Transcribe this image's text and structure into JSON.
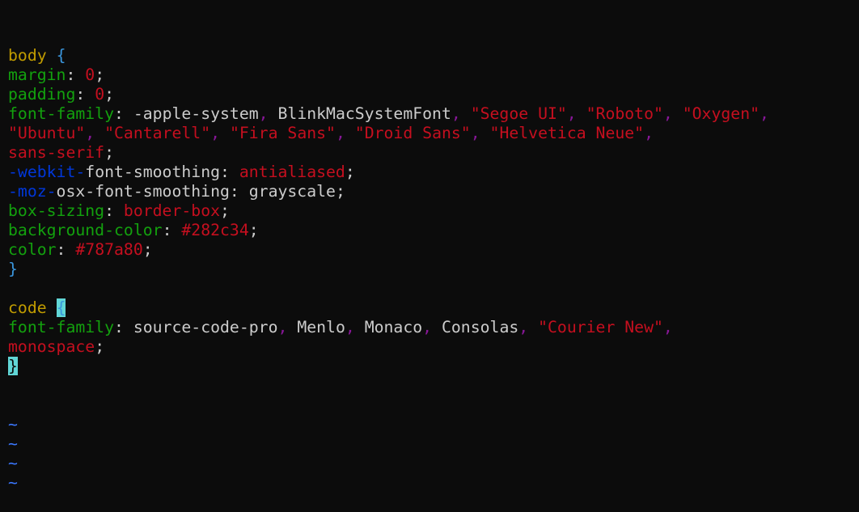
{
  "colors": {
    "background": "#0c0c0c",
    "selector": "#c19c00",
    "brace": "#3a96dd",
    "property": "#13a10e",
    "punctuation": "#cccccc",
    "value": "#c50f1f",
    "separator": "#881798",
    "vendor_prefix": "#0037da",
    "plain": "#cccccc",
    "cursor_bg": "#61d6d6",
    "cursor_fg": "#0c0c0c",
    "tilde": "#3b78ff"
  },
  "lines": [
    [
      {
        "t": "body",
        "c": "selector"
      },
      {
        "t": " ",
        "c": "plain"
      },
      {
        "t": "{",
        "c": "brace"
      }
    ],
    [
      {
        "t": "margin",
        "c": "property"
      },
      {
        "t": ": ",
        "c": "punctuation"
      },
      {
        "t": "0",
        "c": "value"
      },
      {
        "t": ";",
        "c": "punctuation"
      }
    ],
    [
      {
        "t": "padding",
        "c": "property"
      },
      {
        "t": ": ",
        "c": "punctuation"
      },
      {
        "t": "0",
        "c": "value"
      },
      {
        "t": ";",
        "c": "punctuation"
      }
    ],
    [
      {
        "t": "font-family",
        "c": "property"
      },
      {
        "t": ": ",
        "c": "punctuation"
      },
      {
        "t": "-apple-system",
        "c": "plain"
      },
      {
        "t": ", ",
        "c": "separator"
      },
      {
        "t": "BlinkMacSystemFont",
        "c": "plain"
      },
      {
        "t": ", ",
        "c": "separator"
      },
      {
        "t": "\"Segoe UI\"",
        "c": "value"
      },
      {
        "t": ", ",
        "c": "separator"
      },
      {
        "t": "\"Roboto\"",
        "c": "value"
      },
      {
        "t": ", ",
        "c": "separator"
      },
      {
        "t": "\"Oxygen\"",
        "c": "value"
      },
      {
        "t": ",",
        "c": "separator"
      }
    ],
    [
      {
        "t": "\"Ubuntu\"",
        "c": "value"
      },
      {
        "t": ", ",
        "c": "separator"
      },
      {
        "t": "\"Cantarell\"",
        "c": "value"
      },
      {
        "t": ", ",
        "c": "separator"
      },
      {
        "t": "\"Fira Sans\"",
        "c": "value"
      },
      {
        "t": ", ",
        "c": "separator"
      },
      {
        "t": "\"Droid Sans\"",
        "c": "value"
      },
      {
        "t": ", ",
        "c": "separator"
      },
      {
        "t": "\"Helvetica Neue\"",
        "c": "value"
      },
      {
        "t": ",",
        "c": "separator"
      }
    ],
    [
      {
        "t": "sans-serif",
        "c": "value"
      },
      {
        "t": ";",
        "c": "punctuation"
      }
    ],
    [
      {
        "t": "-webkit-",
        "c": "vendor_prefix"
      },
      {
        "t": "font-smoothing",
        "c": "plain"
      },
      {
        "t": ": ",
        "c": "punctuation"
      },
      {
        "t": "antialiased",
        "c": "value"
      },
      {
        "t": ";",
        "c": "punctuation"
      }
    ],
    [
      {
        "t": "-moz-",
        "c": "vendor_prefix"
      },
      {
        "t": "osx-font-smoothing",
        "c": "plain"
      },
      {
        "t": ": ",
        "c": "punctuation"
      },
      {
        "t": "grayscale",
        "c": "plain"
      },
      {
        "t": ";",
        "c": "punctuation"
      }
    ],
    [
      {
        "t": "box-sizing",
        "c": "property"
      },
      {
        "t": ": ",
        "c": "punctuation"
      },
      {
        "t": "border-box",
        "c": "value"
      },
      {
        "t": ";",
        "c": "punctuation"
      }
    ],
    [
      {
        "t": "background-color",
        "c": "property"
      },
      {
        "t": ": ",
        "c": "punctuation"
      },
      {
        "t": "#282c34",
        "c": "value"
      },
      {
        "t": ";",
        "c": "punctuation"
      }
    ],
    [
      {
        "t": "color",
        "c": "property"
      },
      {
        "t": ": ",
        "c": "punctuation"
      },
      {
        "t": "#787a80",
        "c": "value"
      },
      {
        "t": ";",
        "c": "punctuation"
      }
    ],
    [
      {
        "t": "}",
        "c": "brace"
      }
    ],
    [],
    [
      {
        "t": "code",
        "c": "selector"
      },
      {
        "t": " ",
        "c": "plain"
      },
      {
        "t": "{",
        "c": "brace",
        "hl": true
      }
    ],
    [
      {
        "t": "font-family",
        "c": "property"
      },
      {
        "t": ": ",
        "c": "punctuation"
      },
      {
        "t": "source-code-pro",
        "c": "plain"
      },
      {
        "t": ", ",
        "c": "separator"
      },
      {
        "t": "Menlo",
        "c": "plain"
      },
      {
        "t": ", ",
        "c": "separator"
      },
      {
        "t": "Monaco",
        "c": "plain"
      },
      {
        "t": ", ",
        "c": "separator"
      },
      {
        "t": "Consolas",
        "c": "plain"
      },
      {
        "t": ", ",
        "c": "separator"
      },
      {
        "t": "\"Courier New\"",
        "c": "value"
      },
      {
        "t": ",",
        "c": "separator"
      }
    ],
    [
      {
        "t": "monospace",
        "c": "value"
      },
      {
        "t": ";",
        "c": "punctuation"
      }
    ],
    [
      {
        "t": "}",
        "c": "brace",
        "cursor": true
      }
    ]
  ],
  "empty_line_markers": [
    "~",
    "~",
    "~",
    "~"
  ]
}
